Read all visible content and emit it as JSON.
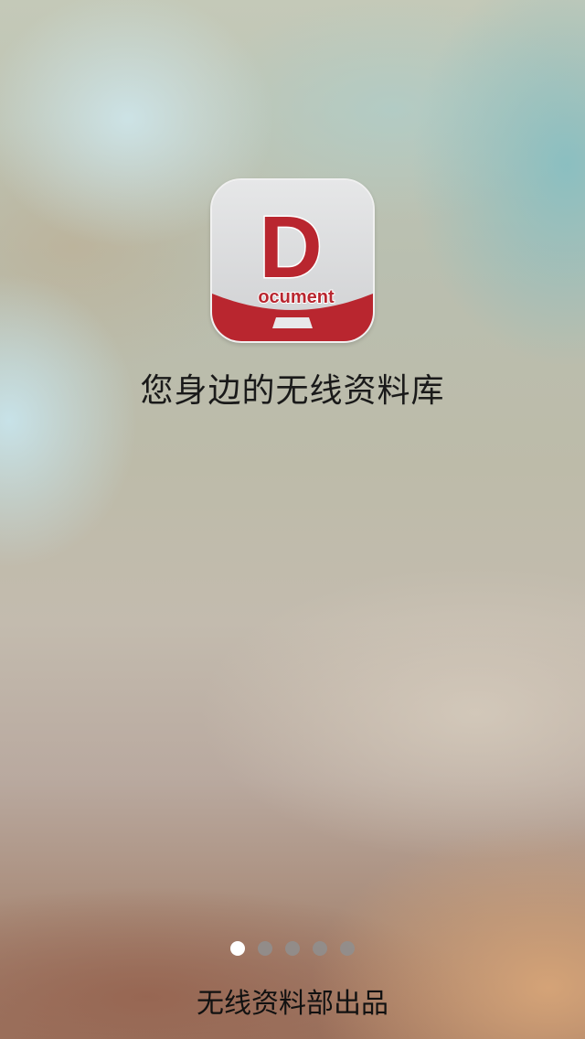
{
  "app_icon": {
    "letter": "D",
    "word": "ocument",
    "icon_name": "document-app-icon",
    "brand_color": "#b9262f"
  },
  "tagline": "您身边的无线资料库",
  "pagination": {
    "total_pages": 5,
    "current_page": 1
  },
  "footer_text": "无线资料部出品"
}
